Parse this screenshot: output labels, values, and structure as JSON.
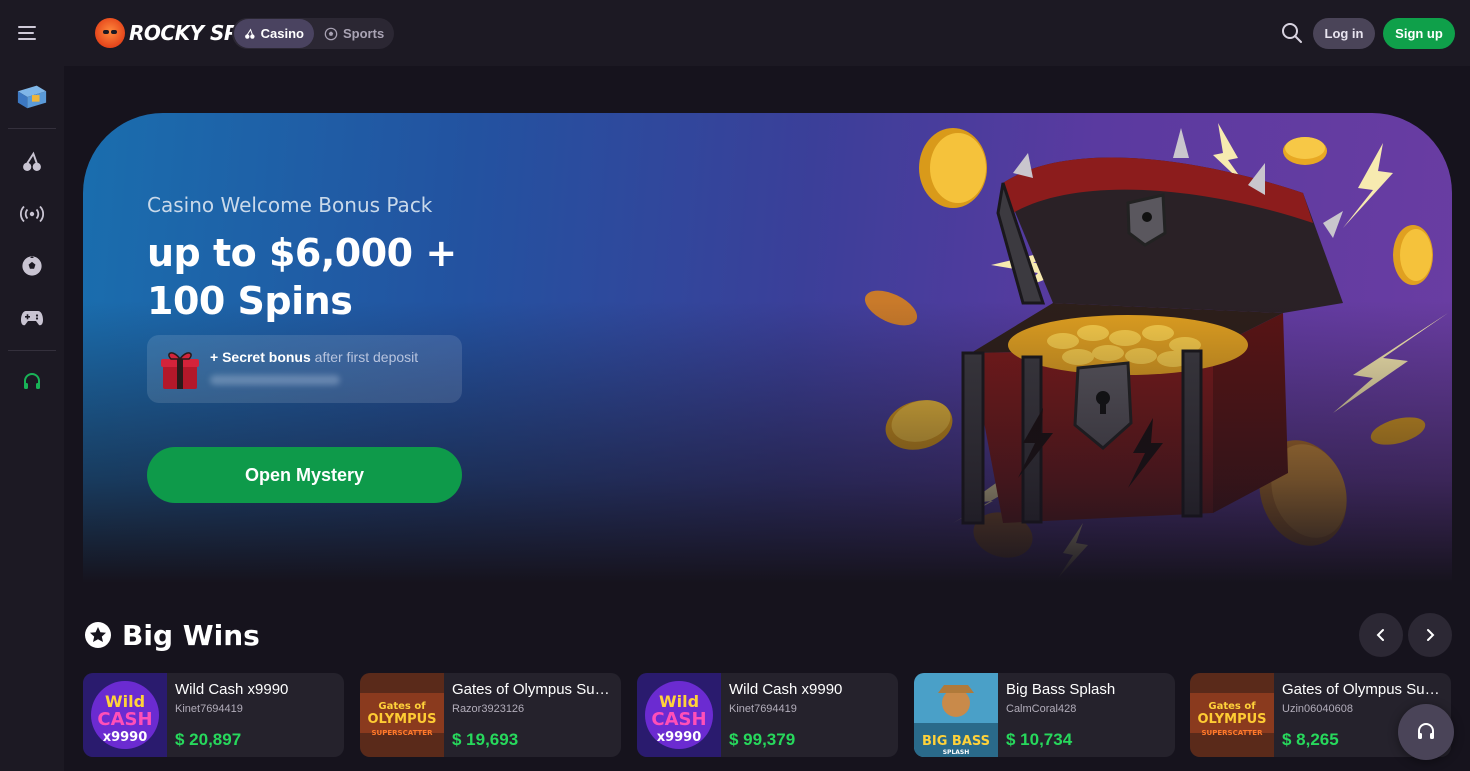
{
  "header": {
    "logo_text": "ROCKY SPIN",
    "modes": [
      {
        "label": "Casino",
        "active": true,
        "icon": "cherry-icon"
      },
      {
        "label": "Sports",
        "active": false,
        "icon": "soccer-ball-icon"
      }
    ],
    "login_label": "Log in",
    "signup_label": "Sign up"
  },
  "sidebar": {
    "items": [
      {
        "icon": "mystery-box-icon"
      },
      {
        "icon": "cherry-icon"
      },
      {
        "icon": "live-broadcast-icon"
      },
      {
        "icon": "soccer-ball-icon"
      },
      {
        "icon": "gamepad-icon"
      },
      {
        "icon": "headset-icon"
      }
    ]
  },
  "hero": {
    "subtitle": "Casino Welcome Bonus Pack",
    "title": "up to $6,000 + 100 Spins",
    "secret_bold": "+ Secret bonus",
    "secret_rest": " after first deposit",
    "cta_label": "Open Mystery"
  },
  "big_wins": {
    "title": "Big Wins",
    "items": [
      {
        "game": "Wild Cash x9990",
        "user": "Kinet7694419",
        "amount": "$ 20,897",
        "thumb": "wild-cash"
      },
      {
        "game": "Gates of Olympus Super Scatter",
        "user": "Razor3923126",
        "amount": "$ 19,693",
        "thumb": "olympus"
      },
      {
        "game": "Wild Cash x9990",
        "user": "Kinet7694419",
        "amount": "$ 99,379",
        "thumb": "wild-cash"
      },
      {
        "game": "Big Bass Splash",
        "user": "CalmCoral428",
        "amount": "$ 10,734",
        "thumb": "big-bass"
      },
      {
        "game": "Gates of Olympus Super Scatter",
        "user": "Uzin06040608",
        "amount": "$ 8,265",
        "thumb": "olympus"
      }
    ]
  },
  "colors": {
    "accent_green": "#0fa04a",
    "win_amount_green": "#27d85c",
    "background": "#16131d"
  }
}
